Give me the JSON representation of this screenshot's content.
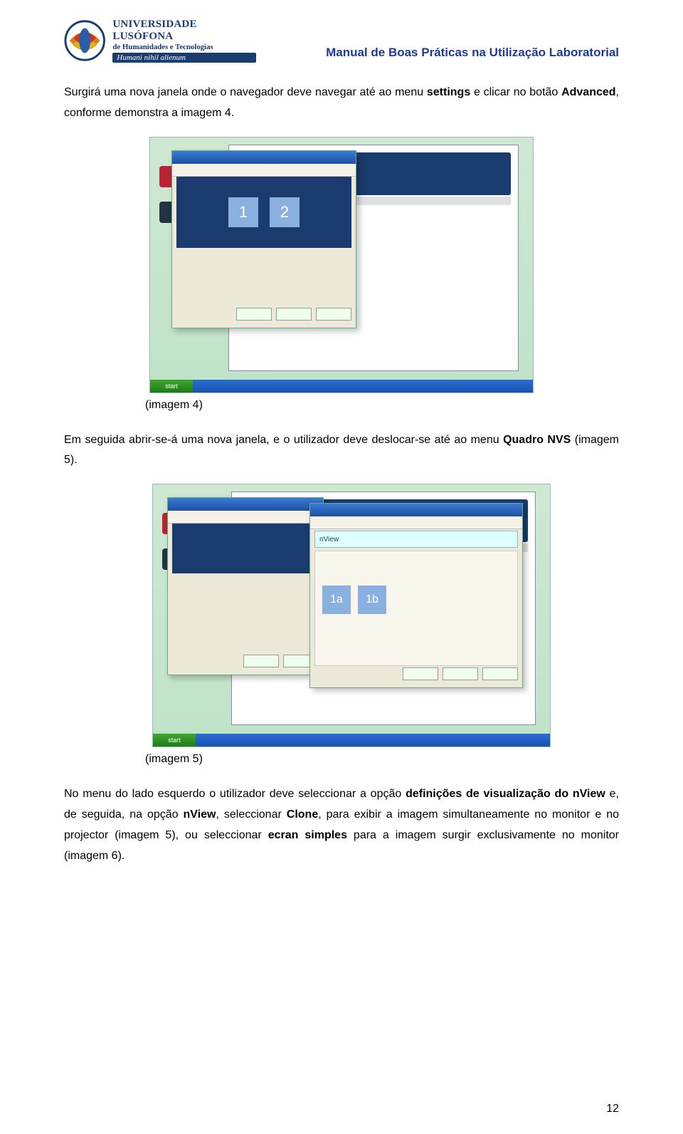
{
  "header": {
    "univ_line1": "UNIVERSIDADE LUSÓFONA",
    "univ_line2": "de Humanidades e Tecnologias",
    "univ_motto": "Humani nihil alienum",
    "doc_title": "Manual de Boas Práticas na Utilização Laboratorial"
  },
  "para1": {
    "t1": "Surgirá uma nova janela onde o navegador deve navegar até ao menu ",
    "b1": "settings",
    "t2": " e clicar no botão ",
    "b2": "Advanced",
    "t3": ", conforme demonstra a imagem 4."
  },
  "caption1": "(imagem 4)",
  "para2": {
    "t1": "Em seguida abrir-se-á uma nova janela, e o utilizador deve deslocar-se até ao menu ",
    "b1": "Quadro NVS",
    "t2": " (imagem 5)."
  },
  "caption2": "(imagem 5)",
  "para3": {
    "t1": "No menu do lado esquerdo o utilizador deve seleccionar a opção ",
    "b1": "definições de visualização do nView",
    "t2": " e, de seguida, na opção ",
    "b2": "nView",
    "t3": ", seleccionar ",
    "b3": "Clone",
    "t4": ", para exibir a imagem simultaneamente no monitor e no projector (imagem 5), ou seleccionar ",
    "b4": "ecran simples",
    "t5": " para a imagem surgir exclusivamente no monitor (imagem 6)."
  },
  "page_number": "12",
  "shots": {
    "start_label": "start",
    "mon1": "1",
    "mon2": "2",
    "mon1a": "1a",
    "mon1b": "1b",
    "nview_label": "nView"
  }
}
